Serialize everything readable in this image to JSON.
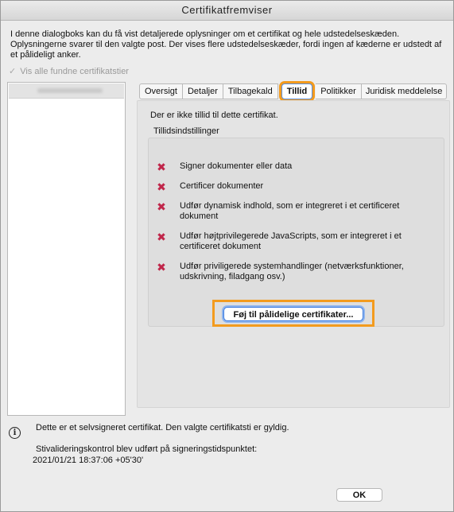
{
  "window": {
    "title": "Certifikatfremviser"
  },
  "intro": {
    "text": "I denne dialogboks kan du få vist detaljerede oplysninger om et certifikat og hele udstedelseskæden. Oplysningerne svarer til den valgte post. Der vises flere udstedelseskæder, fordi ingen af kæderne er udstedt af et pålideligt anker."
  },
  "show_all": {
    "label": "Vis alle fundne certifikatstier",
    "checked": true
  },
  "tabs": [
    {
      "label": "Oversigt"
    },
    {
      "label": "Detaljer"
    },
    {
      "label": "Tilbagekald"
    },
    {
      "label": "Tillid",
      "active": true
    },
    {
      "label": "Politikker"
    },
    {
      "label": "Juridisk meddelelse"
    }
  ],
  "trust": {
    "message": "Der er ikke tillid til dette certifikat.",
    "settings_label": "Tillidsindstillinger",
    "items": [
      {
        "label": "Signer dokumenter eller data"
      },
      {
        "label": "Certificer dokumenter"
      },
      {
        "label": "Udfør dynamisk indhold, som er integreret i et certificeret dokument"
      },
      {
        "label": "Udfør højtprivilegerede JavaScripts, som er integreret i et certificeret dokument"
      },
      {
        "label": "Udfør priviligerede systemhandlinger (netværksfunktioner, udskrivning, filadgang osv.)"
      }
    ],
    "add_button_label": "Føj til pålidelige certifikater..."
  },
  "status": {
    "self_signed": "Dette er et selvsigneret certifikat. Den valgte certifikatsti er gyldig.",
    "validation_label": "Stivalideringskontrol blev udført på signeringstidspunktet:",
    "validation_time": "2021/01/21 18:37:06 +05'30'"
  },
  "buttons": {
    "ok": "OK"
  },
  "colors": {
    "highlight": "#f39b1e",
    "deny_icon": "#c0264a",
    "focus": "#3b7be0"
  },
  "icons": {
    "deny": "x-icon",
    "info": "info-icon",
    "check": "checkmark-icon"
  }
}
